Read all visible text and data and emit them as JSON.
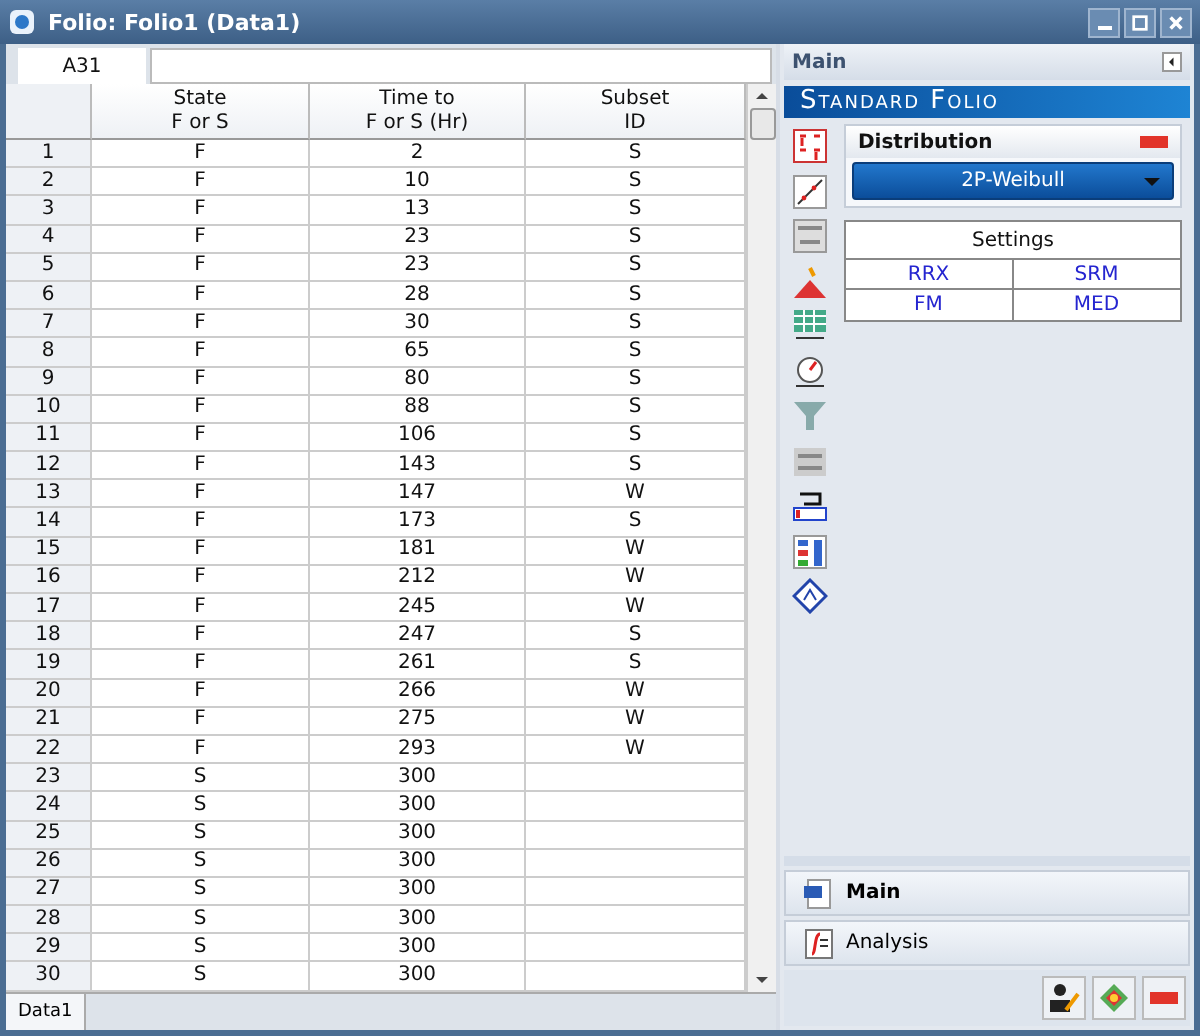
{
  "window": {
    "title": "Folio: Folio1 (Data1)"
  },
  "cell_reference": "A31",
  "table": {
    "columns": [
      "State\nF or S",
      "Time to\nF or S (Hr)",
      "Subset\nID"
    ],
    "rows": [
      {
        "n": "1",
        "state": "F",
        "time": "2",
        "subset": "S"
      },
      {
        "n": "2",
        "state": "F",
        "time": "10",
        "subset": "S"
      },
      {
        "n": "3",
        "state": "F",
        "time": "13",
        "subset": "S"
      },
      {
        "n": "4",
        "state": "F",
        "time": "23",
        "subset": "S"
      },
      {
        "n": "5",
        "state": "F",
        "time": "23",
        "subset": "S"
      },
      {
        "n": "6",
        "state": "F",
        "time": "28",
        "subset": "S"
      },
      {
        "n": "7",
        "state": "F",
        "time": "30",
        "subset": "S"
      },
      {
        "n": "8",
        "state": "F",
        "time": "65",
        "subset": "S"
      },
      {
        "n": "9",
        "state": "F",
        "time": "80",
        "subset": "S"
      },
      {
        "n": "10",
        "state": "F",
        "time": "88",
        "subset": "S"
      },
      {
        "n": "11",
        "state": "F",
        "time": "106",
        "subset": "S"
      },
      {
        "n": "12",
        "state": "F",
        "time": "143",
        "subset": "S"
      },
      {
        "n": "13",
        "state": "F",
        "time": "147",
        "subset": "W"
      },
      {
        "n": "14",
        "state": "F",
        "time": "173",
        "subset": "S"
      },
      {
        "n": "15",
        "state": "F",
        "time": "181",
        "subset": "W"
      },
      {
        "n": "16",
        "state": "F",
        "time": "212",
        "subset": "W"
      },
      {
        "n": "17",
        "state": "F",
        "time": "245",
        "subset": "W"
      },
      {
        "n": "18",
        "state": "F",
        "time": "247",
        "subset": "S"
      },
      {
        "n": "19",
        "state": "F",
        "time": "261",
        "subset": "S"
      },
      {
        "n": "20",
        "state": "F",
        "time": "266",
        "subset": "W"
      },
      {
        "n": "21",
        "state": "F",
        "time": "275",
        "subset": "W"
      },
      {
        "n": "22",
        "state": "F",
        "time": "293",
        "subset": "W"
      },
      {
        "n": "23",
        "state": "S",
        "time": "300"
      },
      {
        "n": "24",
        "state": "S",
        "time": "300"
      },
      {
        "n": "25",
        "state": "S",
        "time": "300"
      },
      {
        "n": "26",
        "state": "S",
        "time": "300"
      },
      {
        "n": "27",
        "state": "S",
        "time": "300"
      },
      {
        "n": "28",
        "state": "S",
        "time": "300"
      },
      {
        "n": "29",
        "state": "S",
        "time": "300"
      },
      {
        "n": "30",
        "state": "S",
        "time": "300"
      }
    ]
  },
  "sheet_tabs": [
    {
      "label": "Data1",
      "selected": true
    }
  ],
  "panel": {
    "title": "Main",
    "banner": "Standard Folio",
    "distribution": {
      "title": "Distribution",
      "value": "2P-Weibull"
    },
    "settings": {
      "title": "Settings",
      "options": [
        "RRX",
        "SRM",
        "FM",
        "MED"
      ]
    }
  },
  "nav": [
    {
      "label": "Main",
      "selected": true
    },
    {
      "label": "Analysis",
      "selected": false
    }
  ]
}
